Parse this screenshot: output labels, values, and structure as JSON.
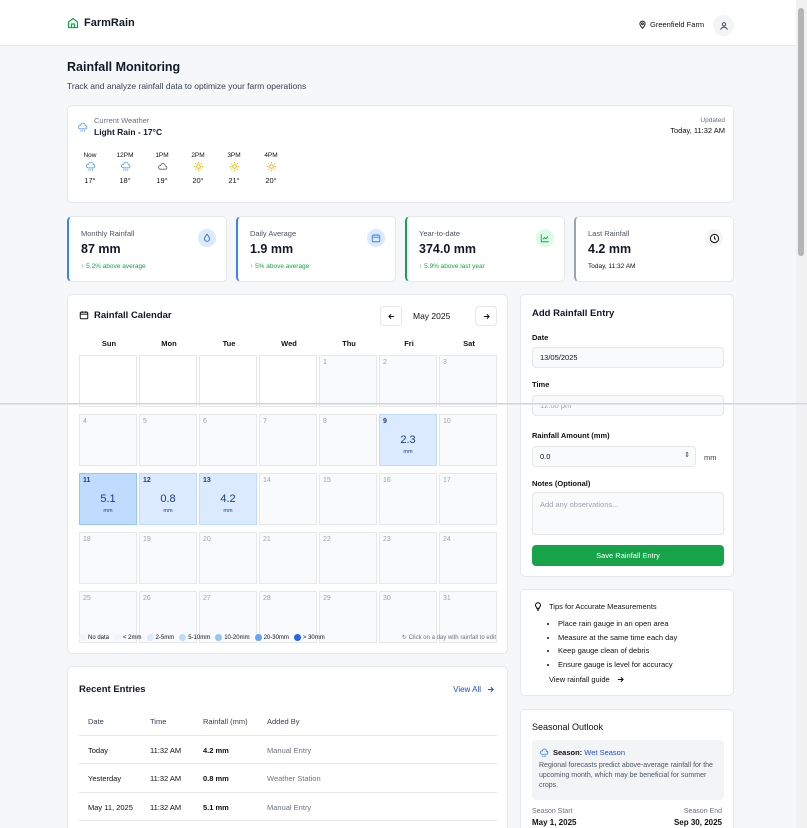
{
  "app": {
    "name": "FarmRain",
    "farm": "Greenfield Farm"
  },
  "page": {
    "title": "Rainfall Monitoring",
    "subtitle": "Track and analyze rainfall data to optimize your farm operations"
  },
  "weather": {
    "label": "Current Weather",
    "condition": "Light Rain - 17°C",
    "updated_label": "Updated",
    "updated_value": "Today, 11:32 AM",
    "hours": [
      {
        "time": "Now",
        "icon": "rain-cloud-icon",
        "temp": "17°"
      },
      {
        "time": "12PM",
        "icon": "rain-cloud-icon",
        "temp": "18°"
      },
      {
        "time": "1PM",
        "icon": "cloud-icon",
        "temp": "19°"
      },
      {
        "time": "2PM",
        "icon": "sun-icon",
        "temp": "20°"
      },
      {
        "time": "3PM",
        "icon": "sun-icon",
        "temp": "21°"
      },
      {
        "time": "4PM",
        "icon": "sun-icon",
        "temp": "20°"
      }
    ]
  },
  "stats": [
    {
      "label": "Monthly Rainfall",
      "value": "87 mm",
      "sub": "5.2% above average",
      "icon": "droplet-icon",
      "accent": "#3b82f6"
    },
    {
      "label": "Daily Average",
      "value": "1.9 mm",
      "sub": "5% above average",
      "icon": "calendar-icon",
      "accent": "#3b82f6"
    },
    {
      "label": "Year-to-date",
      "value": "374.0 mm",
      "sub": "5.9% above last year",
      "icon": "chart-line-icon",
      "accent": "#16a34a"
    },
    {
      "label": "Last Rainfall",
      "value": "4.2 mm",
      "sub": "Today, 11:32 AM",
      "icon": "clock-icon",
      "accent": "#9ca3af"
    }
  ],
  "calendar": {
    "title": "Rainfall Calendar",
    "month": "May 2025",
    "days_of_week": [
      "Sun",
      "Mon",
      "Tue",
      "Wed",
      "Thu",
      "Fri",
      "Sat"
    ],
    "rain": {
      "9": {
        "value": "2.3",
        "unit": "mm"
      },
      "11": {
        "value": "5.1",
        "unit": "mm"
      },
      "12": {
        "value": "0.8",
        "unit": "mm"
      },
      "13": {
        "value": "4.2",
        "unit": "mm"
      }
    },
    "legend": [
      "No data",
      "< 2mm",
      "2-5mm",
      "5-10mm",
      "10-20mm",
      "20-30mm",
      "> 30mm"
    ],
    "legend_colors": [
      "#f3f4f6",
      "#eff6ff",
      "#dbeafe",
      "#bfdbfe",
      "#93c5fd",
      "#60a5fa",
      "#2563eb"
    ],
    "edit_hint": "Click on a day with rainfall to edit"
  },
  "entry_form": {
    "title": "Add Rainfall Entry",
    "date_label": "Date",
    "date_value": "13/05/2025",
    "time_label": "Time",
    "time_value": "12:00 pm",
    "amount_label": "Rainfall Amount (mm)",
    "amount_value": "0.0",
    "amount_unit": "mm",
    "notes_label": "Notes (Optional)",
    "notes_placeholder": "Add any observations...",
    "save_label": "Save Rainfall Entry"
  },
  "tips": {
    "title": "Tips for Accurate Measurements",
    "items": [
      "Place rain gauge in an open area",
      "Measure at the same time each day",
      "Keep gauge clean of debris",
      "Ensure gauge is level for accuracy"
    ],
    "link": "View rainfall guide"
  },
  "recent": {
    "title": "Recent Entries",
    "view_all": "View All",
    "columns": [
      "Date",
      "Time",
      "Rainfall (mm)",
      "Added By"
    ],
    "rows": [
      [
        "Today",
        "11:32 AM",
        "4.2 mm",
        "Manual Entry"
      ],
      [
        "Yesterday",
        "11:32 AM",
        "0.8 mm",
        "Weather Station"
      ],
      [
        "May 11, 2025",
        "11:32 AM",
        "5.1 mm",
        "Manual Entry"
      ]
    ]
  },
  "outlook": {
    "title": "Seasonal Outlook",
    "season_label": "Season:",
    "season_value": "Wet Season",
    "description": "Regional forecasts predict above-average rainfall for the upcoming month, which may be beneficial for summer crops.",
    "start_label": "Season Start",
    "start_value": "May 1, 2025",
    "end_label": "Season End",
    "end_value": "Sep 30, 2025"
  }
}
